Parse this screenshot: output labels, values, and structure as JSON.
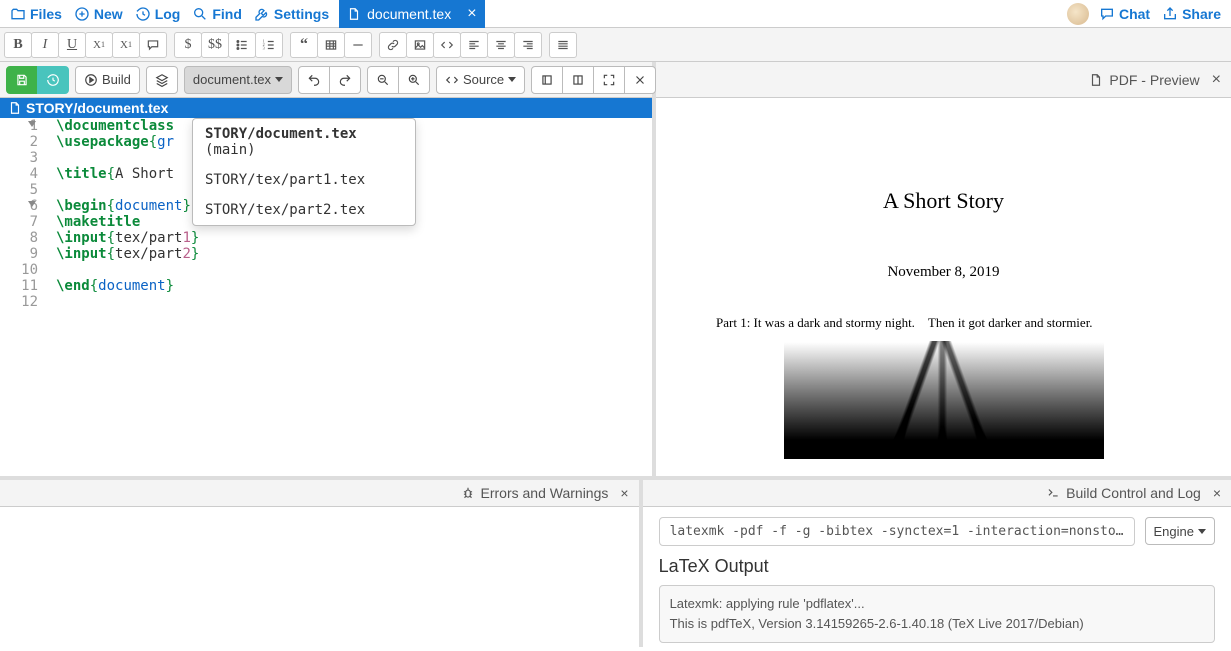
{
  "topbar": {
    "files": "Files",
    "new": "New",
    "log": "Log",
    "find": "Find",
    "settings": "Settings",
    "chat": "Chat",
    "share": "Share",
    "tab_label": "document.tex"
  },
  "toolbar": {
    "build": "Build",
    "file_dd": "document.tex",
    "source": "Source"
  },
  "dropdown": {
    "items": [
      {
        "label": "STORY/document.tex",
        "suffix": "(main)",
        "bold": true
      },
      {
        "label": "STORY/tex/part1.tex",
        "suffix": "",
        "bold": false
      },
      {
        "label": "STORY/tex/part2.tex",
        "suffix": "",
        "bold": false
      }
    ]
  },
  "editor": {
    "path": "STORY/document.tex",
    "lines": [
      [
        {
          "t": "cmd",
          "v": "\\documentclass"
        }
      ],
      [
        {
          "t": "cmd",
          "v": "\\usepackage"
        },
        {
          "t": "br",
          "v": "{"
        },
        {
          "t": "env",
          "v": "gr"
        }
      ],
      [],
      [
        {
          "t": "cmd",
          "v": "\\title"
        },
        {
          "t": "br",
          "v": "{"
        },
        {
          "t": "txt",
          "v": "A Short"
        }
      ],
      [],
      [
        {
          "t": "cmd",
          "v": "\\begin"
        },
        {
          "t": "br",
          "v": "{"
        },
        {
          "t": "env",
          "v": "document"
        },
        {
          "t": "br",
          "v": "}"
        }
      ],
      [
        {
          "t": "cmd",
          "v": "\\maketitle"
        }
      ],
      [
        {
          "t": "cmd",
          "v": "\\input"
        },
        {
          "t": "br",
          "v": "{"
        },
        {
          "t": "txt",
          "v": "tex/part"
        },
        {
          "t": "num",
          "v": "1"
        },
        {
          "t": "br",
          "v": "}"
        }
      ],
      [
        {
          "t": "cmd",
          "v": "\\input"
        },
        {
          "t": "br",
          "v": "{"
        },
        {
          "t": "txt",
          "v": "tex/part"
        },
        {
          "t": "num",
          "v": "2"
        },
        {
          "t": "br",
          "v": "}"
        }
      ],
      [],
      [
        {
          "t": "cmd",
          "v": "\\end"
        },
        {
          "t": "br",
          "v": "{"
        },
        {
          "t": "env",
          "v": "document"
        },
        {
          "t": "br",
          "v": "}"
        }
      ],
      []
    ],
    "fold_lines": [
      1,
      6
    ]
  },
  "pdf": {
    "header": "PDF - Preview",
    "title": "A Short Story",
    "date": "November 8, 2019",
    "paragraph": "Part 1: It was a dark and stormy night. Then it got darker and stormier."
  },
  "bottom_left": {
    "title": "Errors and Warnings"
  },
  "bottom_right": {
    "title": "Build Control and Log",
    "command": "latexmk -pdf -f -g -bibtex -synctex=1 -interaction=nonsto…",
    "engine": "Engine",
    "out_title": "LaTeX Output",
    "output": [
      "Latexmk: applying rule 'pdflatex'...",
      "This is pdfTeX, Version 3.14159265-2.6-1.40.18 (TeX Live 2017/Debian)"
    ]
  }
}
